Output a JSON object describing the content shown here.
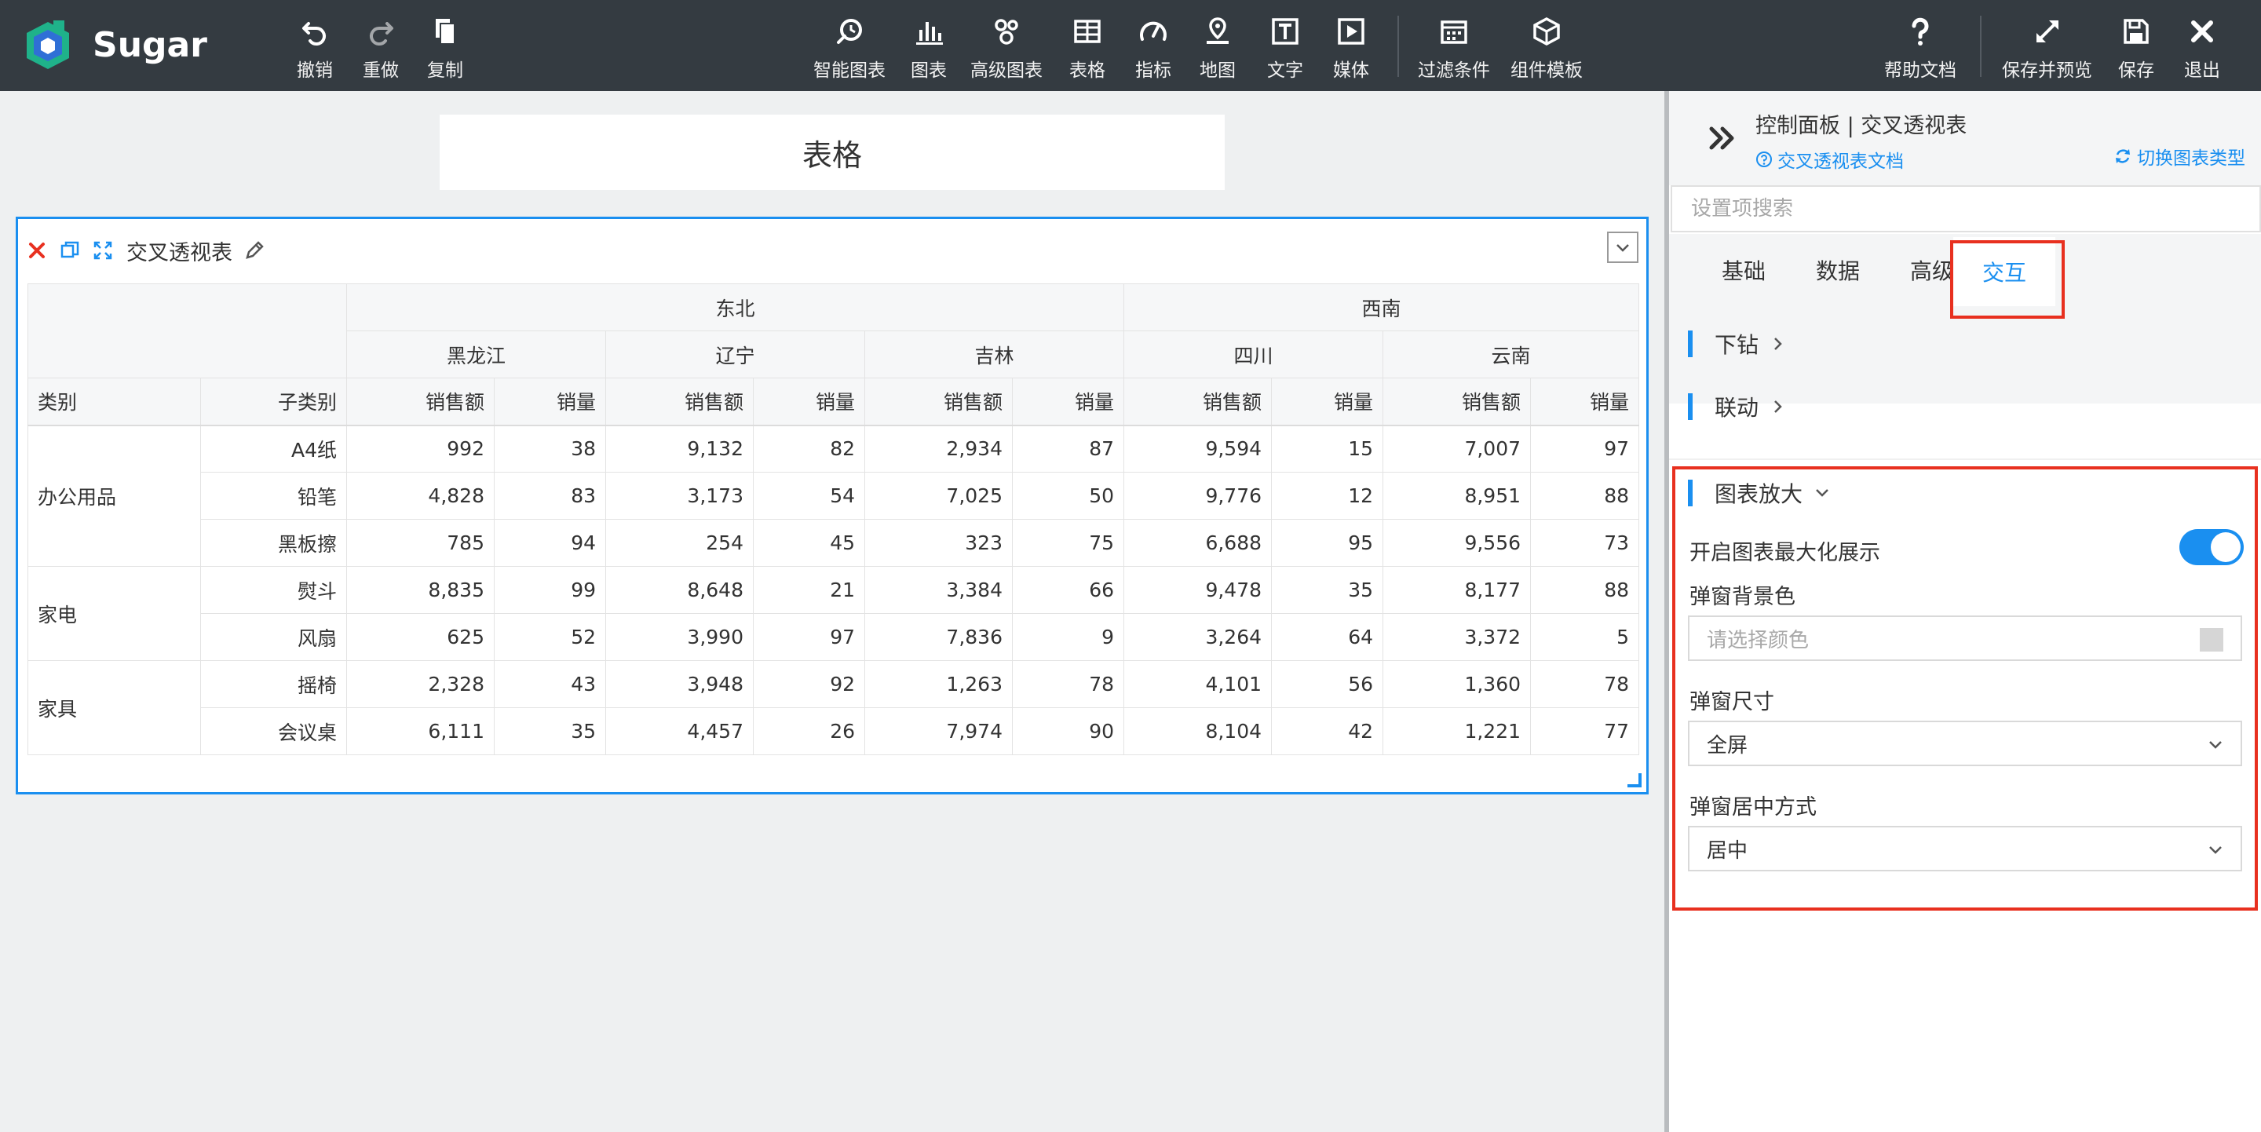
{
  "app": {
    "brand": "Sugar"
  },
  "toolbar": {
    "undo": "撤销",
    "redo": "重做",
    "copy": "复制",
    "smart_chart": "智能图表",
    "chart": "图表",
    "advanced_chart": "高级图表",
    "table": "表格",
    "indicator": "指标",
    "map": "地图",
    "text": "文字",
    "media": "媒体",
    "filter": "过滤条件",
    "template": "组件模板",
    "help": "帮助文档",
    "save_preview": "保存并预览",
    "save": "保存",
    "exit": "退出"
  },
  "canvas": {
    "title": "表格",
    "widget_title": "交叉透视表"
  },
  "pivot": {
    "regions": [
      "东北",
      "西南"
    ],
    "provinces": [
      "黑龙江",
      "辽宁",
      "吉林",
      "四川",
      "云南"
    ],
    "dim_headers": [
      "类别",
      "子类别"
    ],
    "measure_sales": "销售额",
    "measure_qty": "销量",
    "categories": [
      {
        "name": "办公用品",
        "rows": [
          {
            "sub": "A4纸",
            "vals": [
              "992",
              "38",
              "9,132",
              "82",
              "2,934",
              "87",
              "9,594",
              "15",
              "7,007",
              "97"
            ]
          },
          {
            "sub": "铅笔",
            "vals": [
              "4,828",
              "83",
              "3,173",
              "54",
              "7,025",
              "50",
              "9,776",
              "12",
              "8,951",
              "88"
            ]
          },
          {
            "sub": "黑板擦",
            "vals": [
              "785",
              "94",
              "254",
              "45",
              "323",
              "75",
              "6,688",
              "95",
              "9,556",
              "73"
            ]
          }
        ]
      },
      {
        "name": "家电",
        "rows": [
          {
            "sub": "熨斗",
            "vals": [
              "8,835",
              "99",
              "8,648",
              "21",
              "3,384",
              "66",
              "9,478",
              "35",
              "8,177",
              "88"
            ]
          },
          {
            "sub": "风扇",
            "vals": [
              "625",
              "52",
              "3,990",
              "97",
              "7,836",
              "9",
              "3,264",
              "64",
              "3,372",
              "5"
            ]
          }
        ]
      },
      {
        "name": "家具",
        "rows": [
          {
            "sub": "摇椅",
            "vals": [
              "2,328",
              "43",
              "3,948",
              "92",
              "1,263",
              "78",
              "4,101",
              "56",
              "1,360",
              "78"
            ]
          },
          {
            "sub": "会议桌",
            "vals": [
              "6,111",
              "35",
              "4,457",
              "26",
              "7,974",
              "90",
              "8,104",
              "42",
              "1,221",
              "77"
            ]
          }
        ]
      }
    ]
  },
  "panel": {
    "title": "控制面板 | 交叉透视表",
    "doc_link": "交叉透视表文档",
    "switch_type": "切换图表类型",
    "search_placeholder": "设置项搜索",
    "tabs": [
      "基础",
      "数据",
      "高级",
      "交互"
    ],
    "active_tab": "交互",
    "drill": "下钻",
    "linkage": "联动",
    "zoom_section": "图表放大",
    "zoom_enable_label": "开启图表最大化展示",
    "zoom_enabled": true,
    "bg_color_label": "弹窗背景色",
    "bg_color_placeholder": "请选择颜色",
    "size_label": "弹窗尺寸",
    "size_value": "全屏",
    "center_label": "弹窗居中方式",
    "center_value": "居中"
  },
  "colors": {
    "accent": "#1a8ff0",
    "highlight": "#e8301f",
    "toolbar_bg": "#343b41"
  }
}
